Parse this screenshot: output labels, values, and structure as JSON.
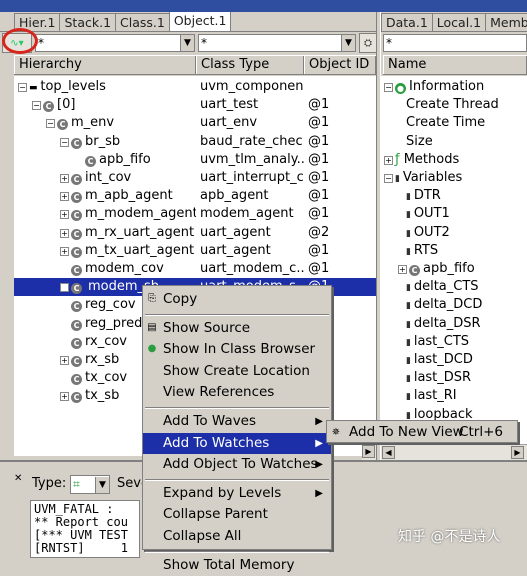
{
  "left_tabs": [
    "Hier.1",
    "Stack.1",
    "Class.1",
    "Object.1"
  ],
  "right_tabs": [
    "Data.1",
    "Local.1",
    "Memb"
  ],
  "filter_left": "*",
  "filter_mid": "*",
  "filter_right": "*",
  "columns": [
    "Hierarchy",
    "Class Type",
    "Object ID"
  ],
  "right_column": "Name",
  "rows": [
    {
      "name": "top_levels",
      "type": "uvm_componen...",
      "id": "",
      "indent": 0,
      "icon": "none",
      "exp": "-"
    },
    {
      "name": "[0]",
      "type": "uart_test",
      "id": "@1",
      "indent": 1,
      "icon": "c",
      "exp": "-"
    },
    {
      "name": "m_env",
      "type": "uart_env",
      "id": "@1",
      "indent": 2,
      "icon": "c",
      "exp": "-"
    },
    {
      "name": "br_sb",
      "type": "baud_rate_chec...",
      "id": "@1",
      "indent": 3,
      "icon": "c",
      "exp": "-"
    },
    {
      "name": "apb_fifo",
      "type": "uvm_tlm_analy...",
      "id": "@1",
      "indent": 4,
      "icon": "c",
      "exp": ""
    },
    {
      "name": "int_cov",
      "type": "uart_interrupt_c...",
      "id": "@1",
      "indent": 3,
      "icon": "c",
      "exp": "+"
    },
    {
      "name": "m_apb_agent",
      "type": "apb_agent",
      "id": "@1",
      "indent": 3,
      "icon": "c",
      "exp": "+"
    },
    {
      "name": "m_modem_agent",
      "type": "modem_agent",
      "id": "@1",
      "indent": 3,
      "icon": "c",
      "exp": "+"
    },
    {
      "name": "m_rx_uart_agent",
      "type": "uart_agent",
      "id": "@2",
      "indent": 3,
      "icon": "c",
      "exp": "+"
    },
    {
      "name": "m_tx_uart_agent",
      "type": "uart_agent",
      "id": "@1",
      "indent": 3,
      "icon": "c",
      "exp": "+"
    },
    {
      "name": "modem_cov",
      "type": "uart_modem_c...",
      "id": "@1",
      "indent": 3,
      "icon": "c",
      "exp": ""
    },
    {
      "name": "modem_sb",
      "type": "uart_modem_s...",
      "id": "@1",
      "indent": 3,
      "icon": "c",
      "exp": "+",
      "selected": true
    },
    {
      "name": "reg_cov",
      "type": "",
      "id": "",
      "indent": 3,
      "icon": "c",
      "exp": ""
    },
    {
      "name": "reg_predictor",
      "type": "",
      "id": "",
      "indent": 3,
      "icon": "c",
      "exp": ""
    },
    {
      "name": "rx_cov",
      "type": "",
      "id": "",
      "indent": 3,
      "icon": "c",
      "exp": ""
    },
    {
      "name": "rx_sb",
      "type": "",
      "id": "",
      "indent": 3,
      "icon": "c",
      "exp": "+"
    },
    {
      "name": "tx_cov",
      "type": "",
      "id": "",
      "indent": 3,
      "icon": "c",
      "exp": ""
    },
    {
      "name": "tx_sb",
      "type": "",
      "id": "",
      "indent": 3,
      "icon": "c",
      "exp": "+"
    }
  ],
  "right_items": [
    {
      "name": "Information",
      "indent": 0,
      "exp": "-",
      "icon": "green"
    },
    {
      "name": "Create Thread",
      "indent": 1,
      "exp": "",
      "icon": ""
    },
    {
      "name": "Create Time",
      "indent": 1,
      "exp": "",
      "icon": ""
    },
    {
      "name": "Size",
      "indent": 1,
      "exp": "",
      "icon": ""
    },
    {
      "name": "Methods",
      "indent": 0,
      "exp": "+",
      "icon": "methods"
    },
    {
      "name": "Variables",
      "indent": 0,
      "exp": "-",
      "icon": "var"
    },
    {
      "name": "DTR",
      "indent": 1,
      "exp": "",
      "icon": "var"
    },
    {
      "name": "OUT1",
      "indent": 1,
      "exp": "",
      "icon": "var"
    },
    {
      "name": "OUT2",
      "indent": 1,
      "exp": "",
      "icon": "var"
    },
    {
      "name": "RTS",
      "indent": 1,
      "exp": "",
      "icon": "var"
    },
    {
      "name": "apb_fifo",
      "indent": 1,
      "exp": "+",
      "icon": "c"
    },
    {
      "name": "delta_CTS",
      "indent": 1,
      "exp": "",
      "icon": "var"
    },
    {
      "name": "delta_DCD",
      "indent": 1,
      "exp": "",
      "icon": "var"
    },
    {
      "name": "delta_DSR",
      "indent": 1,
      "exp": "",
      "icon": "var"
    },
    {
      "name": "last_CTS",
      "indent": 1,
      "exp": "",
      "icon": "var"
    },
    {
      "name": "last_DCD",
      "indent": 1,
      "exp": "",
      "icon": "var"
    },
    {
      "name": "last_DSR",
      "indent": 1,
      "exp": "",
      "icon": "var"
    },
    {
      "name": "last_RI",
      "indent": 1,
      "exp": "",
      "icon": "var"
    },
    {
      "name": "loopback",
      "indent": 1,
      "exp": "",
      "icon": "var"
    }
  ],
  "context_menu": [
    {
      "label": "Copy",
      "icon": "copy"
    },
    {
      "sep": true
    },
    {
      "label": "Show Source",
      "icon": "source"
    },
    {
      "label": "Show In Class Browser",
      "icon": "class"
    },
    {
      "label": "Show Create Location",
      "icon": ""
    },
    {
      "label": "View References",
      "icon": ""
    },
    {
      "sep": true
    },
    {
      "label": "Add To Waves",
      "icon": "",
      "sub": true
    },
    {
      "label": "Add To Watches",
      "icon": "",
      "sub": true,
      "hl": true
    },
    {
      "label": "Add Object To Watches",
      "icon": "",
      "sub": true
    },
    {
      "sep": true
    },
    {
      "label": "Expand by Levels",
      "icon": "",
      "sub": true
    },
    {
      "label": "Collapse Parent",
      "icon": ""
    },
    {
      "label": "Collapse All",
      "icon": ""
    },
    {
      "sep": true
    },
    {
      "label": "Show Total Memory",
      "icon": ""
    }
  ],
  "submenu": {
    "label": "Add To New View",
    "shortcut": "Ctrl+6"
  },
  "bottom": {
    "type_label": "Type:",
    "sev_label": "Seve",
    "console_lines": [
      "UVM_FATAL :",
      "** Report cou",
      "[*** UVM TEST",
      "[RNTST]     1"
    ]
  },
  "watermark": "知乎 @不是诗人"
}
